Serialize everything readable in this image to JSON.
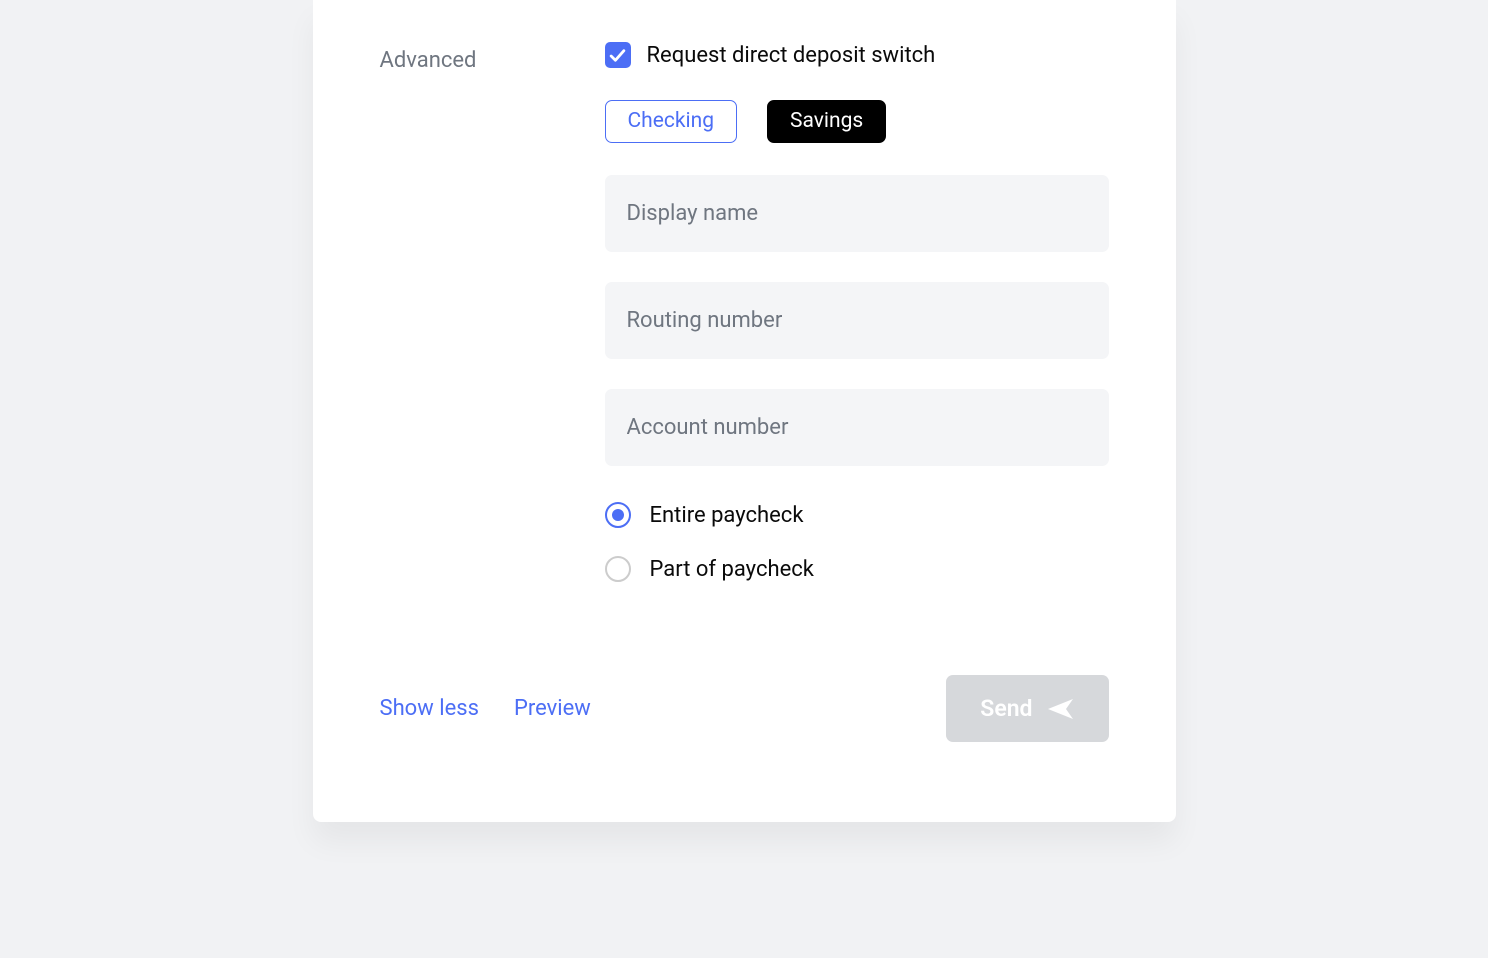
{
  "section": {
    "label": "Advanced"
  },
  "checkbox": {
    "label": "Request direct deposit switch",
    "checked": true
  },
  "account_type": {
    "checking_label": "Checking",
    "savings_label": "Savings",
    "selected": "savings"
  },
  "inputs": {
    "display_name": {
      "placeholder": "Display name",
      "value": ""
    },
    "routing_number": {
      "placeholder": "Routing number",
      "value": ""
    },
    "account_number": {
      "placeholder": "Account number",
      "value": ""
    }
  },
  "paycheck": {
    "entire_label": "Entire paycheck",
    "part_label": "Part of paycheck",
    "selected": "entire"
  },
  "footer": {
    "show_less": "Show less",
    "preview": "Preview",
    "send": "Send"
  },
  "colors": {
    "accent": "#4c6ef5",
    "muted": "#6f7680",
    "input_bg": "#f4f5f7",
    "disabled_btn": "#d6d8db"
  }
}
